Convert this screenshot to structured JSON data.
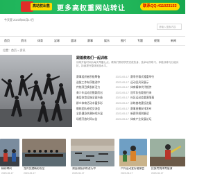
{
  "banner": {
    "badge": "高站权出售",
    "headline": "更多高权重网站转让",
    "qq": "联系QQ:411023153"
  },
  "header": {
    "dateline": "今天是 2023年05月17日",
    "search_placeholder": "请输入搜索内容"
  },
  "nav": {
    "items": [
      "首页",
      "资讯",
      "体育",
      "足球",
      "篮球",
      "赛事",
      "娱乐",
      "图片",
      "专题",
      "视频",
      "新闻"
    ]
  },
  "breadcrumb": "位置：首页 > 资讯",
  "hero": {
    "title": "跟着教练们一起训练",
    "desc": "训练开始时间为每天早晨七点，教练们带领学员完成热身、技术动作练习、体能训练与分组对抗，持续提升整体竞技水平。"
  },
  "list_left": [
    {
      "title": "赛事组织者积极筹备",
      "date": "2023-05-17"
    },
    {
      "title": "选拔工作有序推进中",
      "date": "2023-05-17"
    },
    {
      "title": "传统项目焕发新活力",
      "date": "2023-05-17"
    },
    {
      "title": "青少年运动员脱颖而出",
      "date": "2023-05-17"
    },
    {
      "title": "基层体育设施全面升级",
      "date": "2023-05-17"
    },
    {
      "title": "群众体育活动丰富多彩",
      "date": "2023-05-17"
    },
    {
      "title": "教练团队经验交流会",
      "date": "2023-05-17"
    },
    {
      "title": "全民健身热潮持续升温",
      "date": "2023-05-17"
    },
    {
      "title": "场馆开放时间公告",
      "date": "2023-05-17"
    }
  ],
  "list_right": [
    {
      "title": "赛季开幕式隆重举行",
      "date": "2023-05-17"
    },
    {
      "title": "运动员风采展示",
      "date": "2023-05-17"
    },
    {
      "title": "体育精神代代相传",
      "date": "2023-05-17"
    },
    {
      "title": "冠军队伍载誉归来",
      "date": "2023-05-17"
    },
    {
      "title": "社区运动会圆满落幕",
      "date": "2023-05-17"
    },
    {
      "title": "训练基地建设进展",
      "date": "2023-05-17"
    },
    {
      "title": "赛事直播安排发布",
      "date": "2023-05-17"
    },
    {
      "title": "新赛季规则解读",
      "date": "2023-05-17"
    },
    {
      "title": "体育产业发展论坛",
      "date": "2023-05-17"
    }
  ],
  "thumbs": [
    {
      "caption": "精彩瞬间",
      "date": "2023-05-17"
    },
    {
      "caption": "龙舟竞渡精彩纷呈",
      "date": "2023-05-17"
    },
    {
      "caption": "湖面赛艇训练进行中",
      "date": "2023-05-17"
    },
    {
      "caption": "户外运动爱好者聚会",
      "date": "2023-05-17"
    },
    {
      "caption": "民族传统体育展演",
      "date": "2023-05-17"
    }
  ]
}
